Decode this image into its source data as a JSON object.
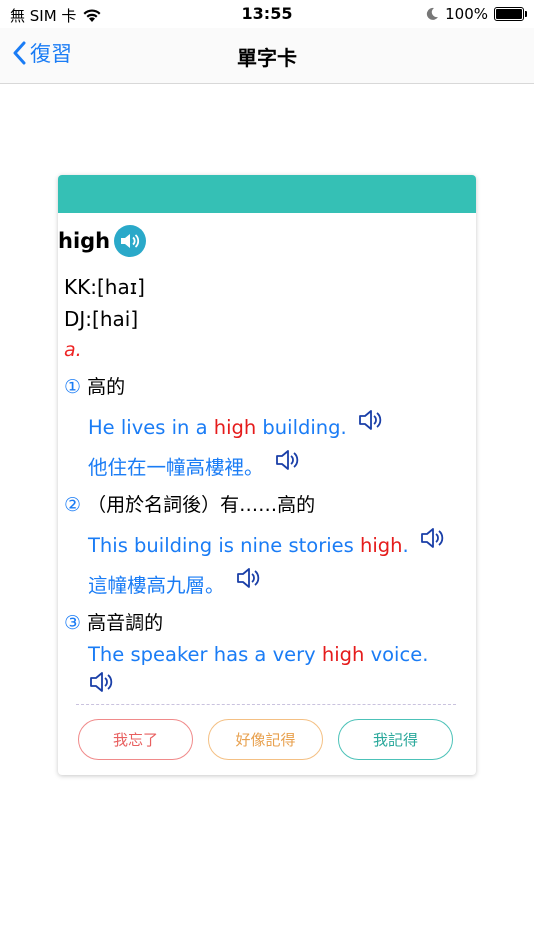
{
  "status_bar": {
    "carrier": "無 SIM 卡",
    "time": "13:55",
    "battery_percent": "100%",
    "battery_level": 1.0
  },
  "nav": {
    "back_label": "復習",
    "title": "單字卡"
  },
  "card": {
    "word": "high",
    "kk": "KK:[haɪ]",
    "dj": "DJ:[hai]",
    "pos": "a.",
    "senses": [
      {
        "num": "①",
        "def": "高的",
        "example_en": {
          "before": "He lives in a ",
          "highlight": "high",
          "after": " building."
        },
        "example_zh": "他住在一幢高樓裡。"
      },
      {
        "num": "②",
        "def": "（用於名詞後）有……高的",
        "example_en": {
          "before": "This building is nine stories ",
          "highlight": "high",
          "after": "."
        },
        "example_zh": "這幢樓高九層。"
      },
      {
        "num": "③",
        "def": "高音調的",
        "example_en": {
          "before": "The speaker has a very ",
          "highlight": "high",
          "after": " voice."
        },
        "example_zh": ""
      }
    ],
    "buttons": {
      "forgot": "我忘了",
      "maybe": "好像記得",
      "remember": "我記得"
    }
  },
  "colors": {
    "accent": "#35c0b5",
    "link_blue": "#1a7cf5",
    "highlight_red": "#e51b1b"
  }
}
